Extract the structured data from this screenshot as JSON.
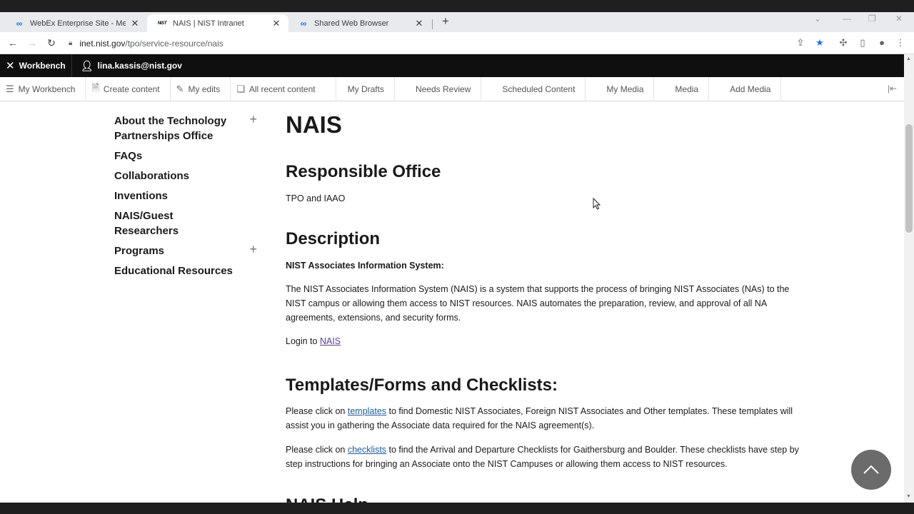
{
  "browser": {
    "tabs": [
      {
        "title": "WebEx Enterprise Site - Meeting",
        "icon": "webex-icon"
      },
      {
        "title": "NAIS | NIST Intranet",
        "icon": "nist-icon",
        "icon_text": "NIST"
      },
      {
        "title": "Shared Web Browser",
        "icon": "webex-icon"
      }
    ],
    "url_host": "inet.nist.gov",
    "url_path": "/tpo/service-resource/nais"
  },
  "admin_toolbar": {
    "workbench_label": "Workbench",
    "user_label": "lina.kassis@nist.gov"
  },
  "tray": {
    "items": [
      {
        "label": "My Workbench"
      },
      {
        "label": "Create content"
      },
      {
        "label": "My edits"
      },
      {
        "label": "All recent content"
      },
      {
        "label": "My Drafts"
      },
      {
        "label": "Needs Review"
      },
      {
        "label": "Scheduled Content"
      },
      {
        "label": "My Media"
      },
      {
        "label": "Media"
      },
      {
        "label": "Add Media"
      }
    ]
  },
  "sidebar": {
    "items": [
      {
        "label": "About the Technology Partnerships Office",
        "expandable": true
      },
      {
        "label": "FAQs"
      },
      {
        "label": "Collaborations"
      },
      {
        "label": "Inventions"
      },
      {
        "label": "NAIS/Guest Researchers"
      },
      {
        "label": "Programs",
        "expandable": true
      },
      {
        "label": "Educational Resources"
      }
    ]
  },
  "content": {
    "title": "NAIS",
    "responsible_heading": "Responsible Office",
    "responsible_text": "TPO and IAAO",
    "description_heading": "Description",
    "description_subheading": "NIST Associates Information System:",
    "description_text": "The NIST Associates Information System (NAIS) is a system that supports the process of bringing NIST Associates (NAs) to the NIST campus or allowing them access to NIST resources. NAIS automates the preparation, review, and approval of all NA agreements, extensions, and security forms.",
    "login_prefix": "Login to ",
    "login_link": "NAIS",
    "templates_heading": "Templates/Forms and Checklists:",
    "templates_prefix": "Please click on ",
    "templates_link": "templates",
    "templates_suffix": " to find Domestic NIST Associates, Foreign NIST Associates and Other templates. These  templates will assist you in gathering the Associate data required for the NAIS agreement(s).",
    "checklists_prefix": "Please click on ",
    "checklists_link": "checklists",
    "checklists_suffix": " to find the Arrival and Departure Checklists for Gaithersburg and Boulder. These checklists have step by step instructions for bringing an Associate onto the NIST Campuses or allowing them access to NIST resources.",
    "next_heading": "NAIS Help"
  }
}
